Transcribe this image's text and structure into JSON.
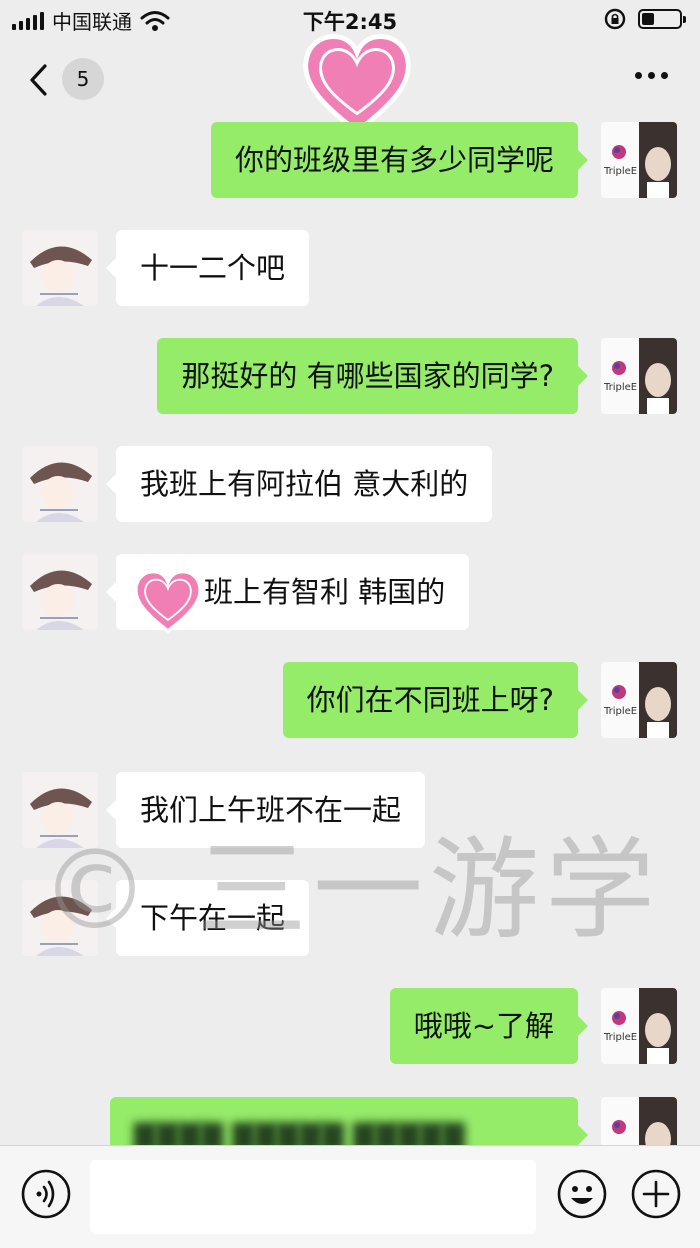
{
  "status_bar": {
    "carrier": "中国联通",
    "time": "下午2:45"
  },
  "nav": {
    "unread_count": "5"
  },
  "messages": [
    {
      "side": "out",
      "text": "你的班级里有多少同学呢"
    },
    {
      "side": "in",
      "text": "十一二个吧"
    },
    {
      "side": "out",
      "text": "那挺好的 有哪些国家的同学?"
    },
    {
      "side": "in",
      "text": "我班上有阿拉伯 意大利的"
    },
    {
      "side": "in",
      "text": "班上有智利 韩国的"
    },
    {
      "side": "out",
      "text": "你们在不同班上呀?"
    },
    {
      "side": "in",
      "text": "我们上午班不在一起"
    },
    {
      "side": "in",
      "text": "下午在一起"
    },
    {
      "side": "out",
      "text": "哦哦~了解"
    },
    {
      "side": "out",
      "text": "▇▇▇▇ ▇▇▇▇▇ ▇▇▇▇▇"
    }
  ],
  "avatar_self_logo": "TripleE",
  "watermark": "© 三一游学",
  "colors": {
    "outgoing_bubble": "#95ec69",
    "incoming_bubble": "#ffffff",
    "background": "#ededed",
    "heart": "#f07fb6"
  },
  "icons": [
    "back-chevron-icon",
    "more-icon",
    "voice-icon",
    "emoji-icon",
    "plus-icon",
    "heart-sticker-icon",
    "wifi-icon",
    "battery-icon",
    "orientation-lock-icon"
  ]
}
